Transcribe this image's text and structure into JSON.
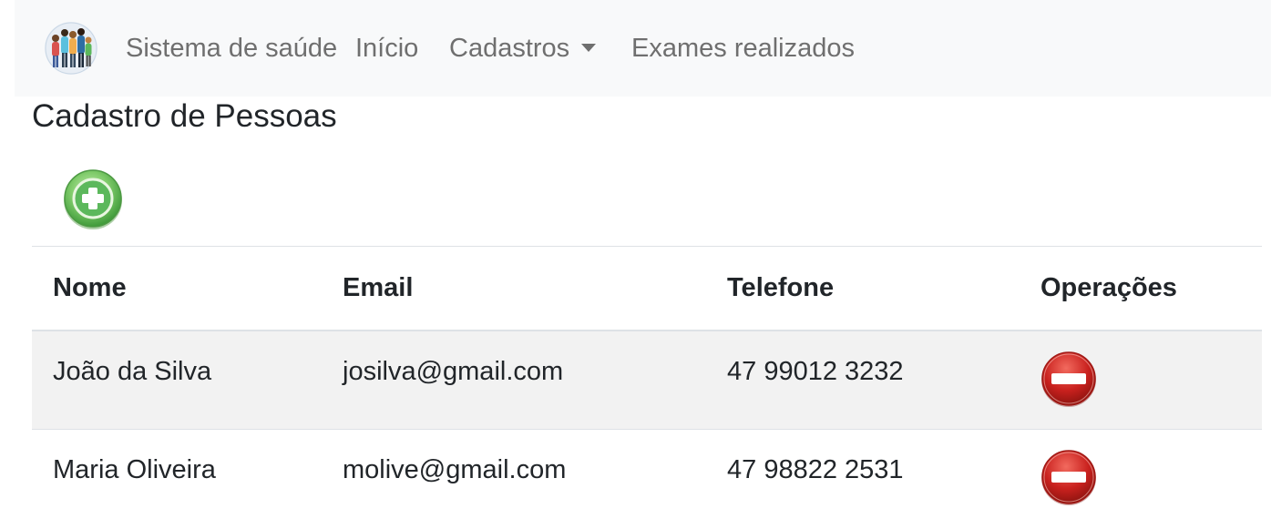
{
  "navbar": {
    "brand_text": "Sistema de saúde",
    "logo_icon": "people-group-icon",
    "links": [
      {
        "label": "Início"
      },
      {
        "label": "Cadastros",
        "has_dropdown": true
      },
      {
        "label": "Exames realizados"
      }
    ]
  },
  "page": {
    "title": "Cadastro de Pessoas",
    "add_icon": "green-plus-circle-icon"
  },
  "table": {
    "headers": [
      "Nome",
      "Email",
      "Telefone",
      "Operações"
    ],
    "rows": [
      {
        "nome": "João da Silva",
        "email": "josilva@gmail.com",
        "telefone": "47 99012 3232",
        "operation_icon": "red-minus-circle-icon"
      },
      {
        "nome": "Maria Oliveira",
        "email": "molive@gmail.com",
        "telefone": "47 98822 2531",
        "operation_icon": "red-minus-circle-icon"
      }
    ]
  },
  "colors": {
    "navbar_bg": "#f8f9fa",
    "nav_text": "#6f6f6f",
    "stripe": "#f2f2f2",
    "add_green": "#5cb85c",
    "delete_red": "#c9211e"
  }
}
